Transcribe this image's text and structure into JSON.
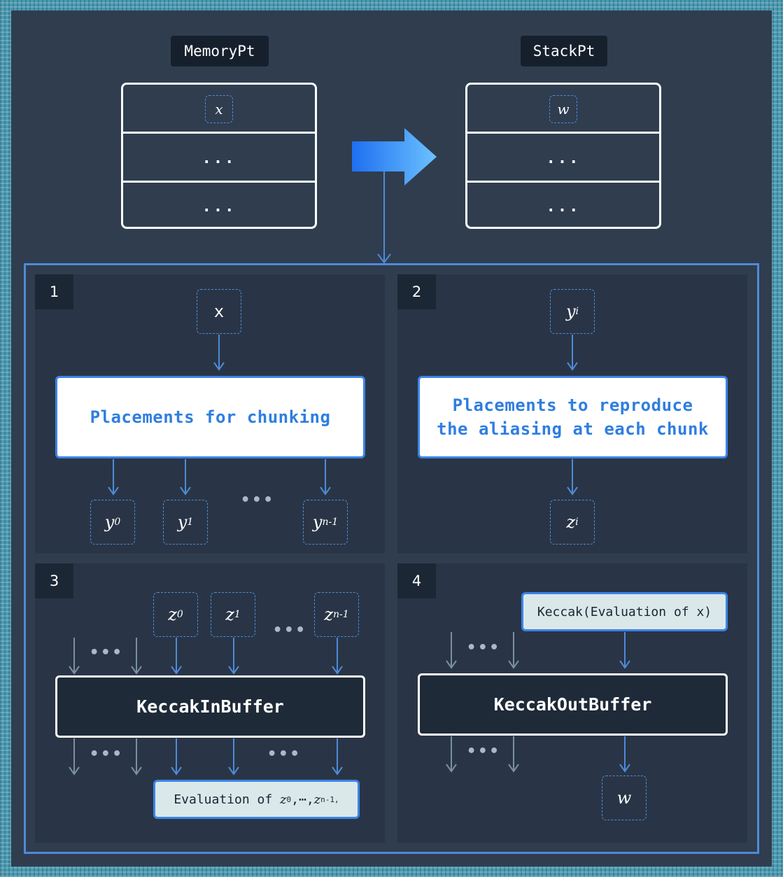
{
  "top": {
    "memory_label": "MemoryPt",
    "stack_label": "StackPt",
    "memory_rows": [
      "x",
      "...",
      "..."
    ],
    "stack_rows": [
      "w",
      "...",
      "..."
    ]
  },
  "quadrants": {
    "q1": {
      "number": "1",
      "input": "x",
      "box": "Placements for chunking",
      "outputs": [
        {
          "base": "y",
          "sub": "0"
        },
        {
          "base": "y",
          "sub": "1"
        },
        {
          "base": "y",
          "sub": "n-1"
        }
      ],
      "ellipsis": "•••"
    },
    "q2": {
      "number": "2",
      "input": {
        "base": "y",
        "sub": "i"
      },
      "box_line1": "Placements to reproduce",
      "box_line2": "the aliasing at each chunk",
      "output": {
        "base": "z",
        "sub": "i"
      }
    },
    "q3": {
      "number": "3",
      "inputs": [
        {
          "base": "z",
          "sub": "0"
        },
        {
          "base": "z",
          "sub": "1"
        },
        {
          "base": "z",
          "sub": "n-1"
        }
      ],
      "box": "KeccakInBuffer",
      "eval_prefix": "Evaluation of ",
      "eval_vars": [
        "z",
        "0",
        "z",
        "n-1"
      ],
      "ellipsis": "•••"
    },
    "q4": {
      "number": "4",
      "chip": "Keccak(Evaluation of x)",
      "box": "KeccakOutBuffer",
      "output": "w",
      "ellipsis": "•••"
    }
  },
  "colors": {
    "accent": "#3c84e8",
    "panel": "#2f3d4f",
    "quad": "#293546",
    "border_pattern": "#4a9bb3"
  }
}
